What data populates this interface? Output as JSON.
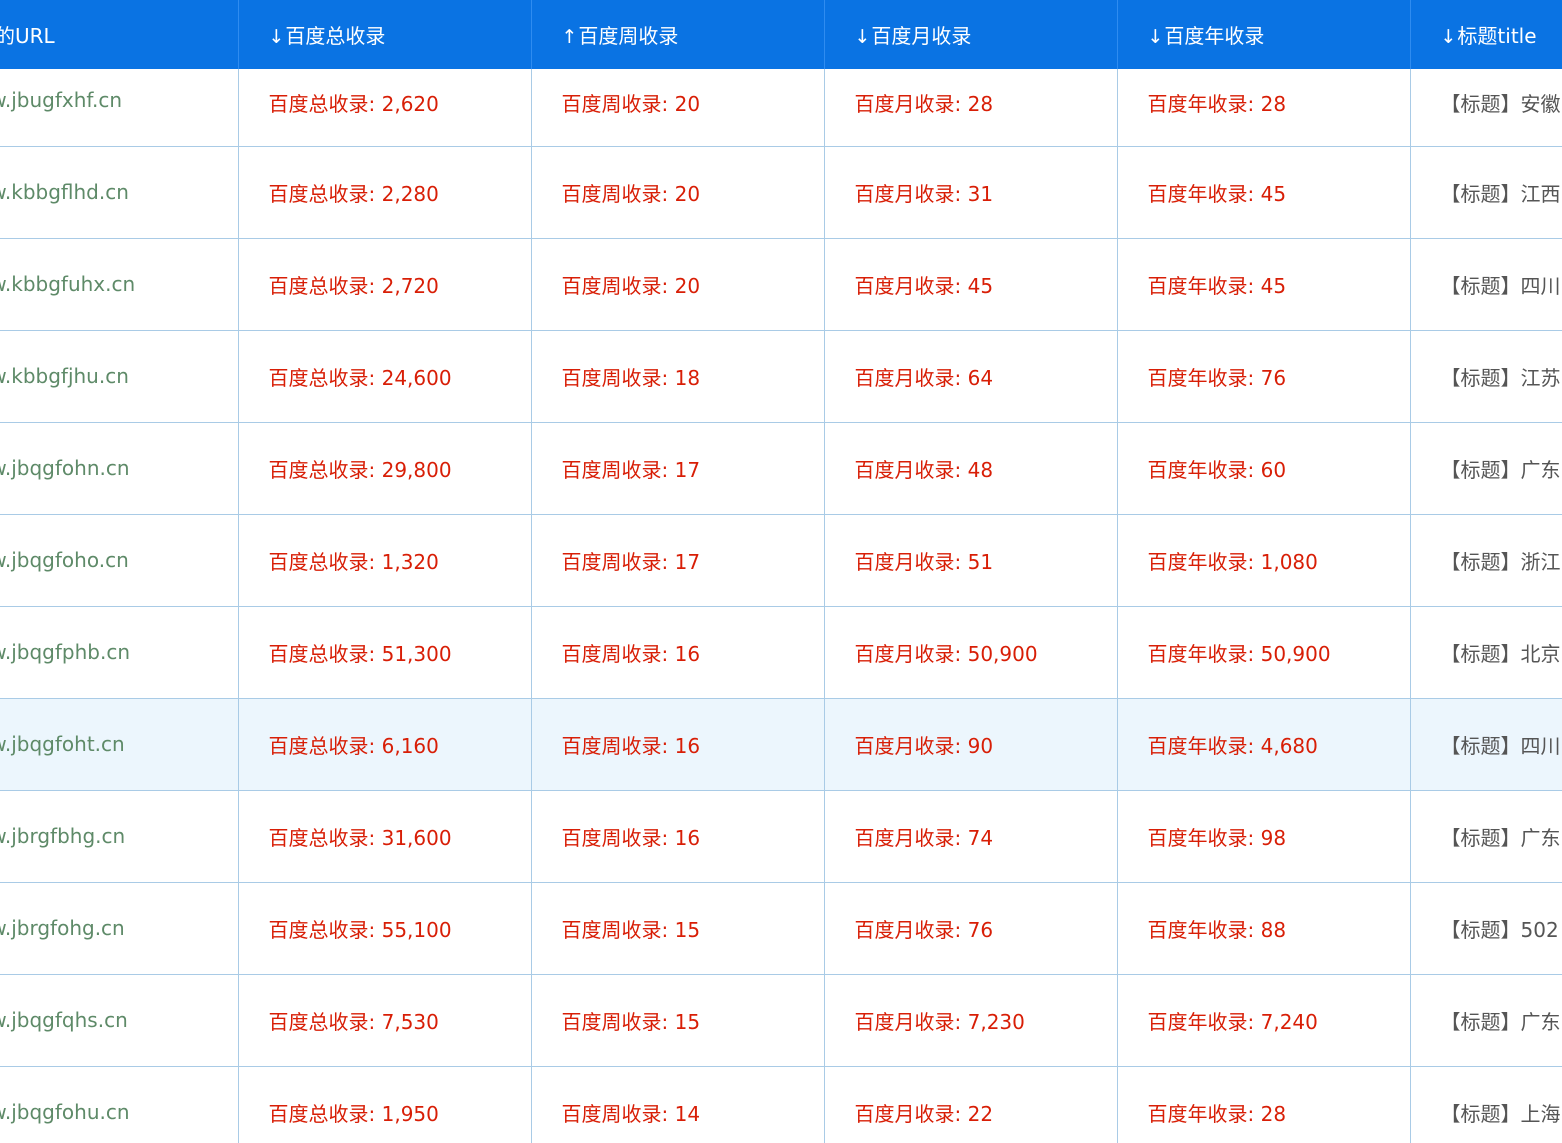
{
  "columns": [
    {
      "arrow": "",
      "label": "询的URL"
    },
    {
      "arrow": "↓",
      "label": "百度总收录"
    },
    {
      "arrow": "↑",
      "label": "百度周收录"
    },
    {
      "arrow": "↓",
      "label": "百度月收录"
    },
    {
      "arrow": "↓",
      "label": "百度年收录"
    },
    {
      "arrow": "↓",
      "label": "标题title"
    }
  ],
  "prefixes": {
    "total": "百度总收录: ",
    "week": "百度周收录: ",
    "month": "百度月收录: ",
    "year": "百度年收录: ",
    "title_tag": "【标题】"
  },
  "rows": [
    {
      "url": "ww.jbugfxhf.cn",
      "total": "2,620",
      "week": "20",
      "month": "28",
      "year": "28",
      "title": "安徽"
    },
    {
      "url": "ww.kbbgflhd.cn",
      "total": "2,280",
      "week": "20",
      "month": "31",
      "year": "45",
      "title": "江西"
    },
    {
      "url": "ww.kbbgfuhx.cn",
      "total": "2,720",
      "week": "20",
      "month": "45",
      "year": "45",
      "title": "四川"
    },
    {
      "url": "ww.kbbgfjhu.cn",
      "total": "24,600",
      "week": "18",
      "month": "64",
      "year": "76",
      "title": "江苏"
    },
    {
      "url": "ww.jbqgfohn.cn",
      "total": "29,800",
      "week": "17",
      "month": "48",
      "year": "60",
      "title": "广东"
    },
    {
      "url": "ww.jbqgfoho.cn",
      "total": "1,320",
      "week": "17",
      "month": "51",
      "year": "1,080",
      "title": "浙江"
    },
    {
      "url": "ww.jbqgfphb.cn",
      "total": "51,300",
      "week": "16",
      "month": "50,900",
      "year": "50,900",
      "title": "北京"
    },
    {
      "url": "ww.jbqgfoht.cn",
      "total": "6,160",
      "week": "16",
      "month": "90",
      "year": "4,680",
      "title": "四川"
    },
    {
      "url": "ww.jbrgfbhg.cn",
      "total": "31,600",
      "week": "16",
      "month": "74",
      "year": "98",
      "title": "广东"
    },
    {
      "url": "ww.jbrgfohg.cn",
      "total": "55,100",
      "week": "15",
      "month": "76",
      "year": "88",
      "title": "502"
    },
    {
      "url": "ww.jbqgfqhs.cn",
      "total": "7,530",
      "week": "15",
      "month": "7,230",
      "year": "7,240",
      "title": "广东"
    },
    {
      "url": "ww.jbqgfohu.cn",
      "total": "1,950",
      "week": "14",
      "month": "22",
      "year": "28",
      "title": "上海"
    }
  ]
}
